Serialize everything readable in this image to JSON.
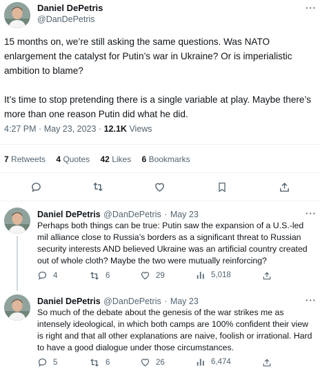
{
  "main_tweet": {
    "author_name": "Daniel DePetris",
    "author_handle": "@DanDePetris",
    "paragraph_1": "15 months on, we’re still asking the same questions. Was NATO enlargement the catalyst for Putin’s war in Ukraine? Or is imperialistic ambition to blame?",
    "paragraph_2": "It’s time to stop pretending there is a single variable at play. Maybe there’s more than one reason Putin did what he did.",
    "time": "4:27 PM",
    "date": "May 23, 2023",
    "views_count": "12.1K",
    "views_label": "Views",
    "retweets_count": "7",
    "retweets_label": "Retweets",
    "quotes_count": "4",
    "quotes_label": "Quotes",
    "likes_count": "42",
    "likes_label": "Likes",
    "bookmarks_count": "6",
    "bookmarks_label": "Bookmarks"
  },
  "replies": [
    {
      "author_name": "Daniel DePetris",
      "author_handle": "@DanDePetris",
      "date": "May 23",
      "text": "Perhaps both things can be true: Putin saw the expansion of a U.S.-led mil alliance close to Russia’s borders as a significant threat to Russian security interests AND believed Ukraine was an artificial country created out of whole cloth? Maybe the two were mutually reinforcing?",
      "replies": "4",
      "retweets": "6",
      "likes": "29",
      "views": "5,018"
    },
    {
      "author_name": "Daniel DePetris",
      "author_handle": "@DanDePetris",
      "date": "May 23",
      "text": "So much of the debate about the genesis of the war strikes me as intensely ideological, in which both camps are 100% confident their view is right and that all other explanations are naive, foolish or irrational. Hard to have a good dialogue under those circumstances.",
      "replies": "5",
      "retweets": "6",
      "likes": "26",
      "views": "6,474"
    }
  ],
  "separator": "·",
  "more_glyph": "···",
  "icons": [
    "more-icon",
    "reply-icon",
    "retweet-icon",
    "like-icon",
    "bookmark-icon",
    "share-icon",
    "views-icon"
  ],
  "colors": {
    "text": "#0f1419",
    "secondary": "#536471",
    "divider": "#eff3f4",
    "thread_line": "#cfd9de"
  }
}
